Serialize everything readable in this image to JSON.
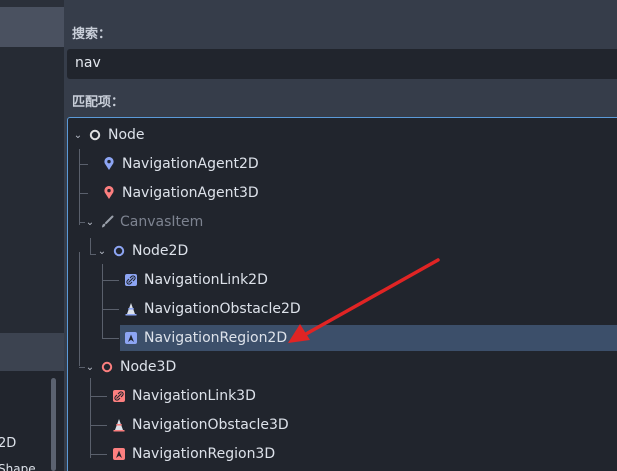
{
  "left_panel": {
    "text_2d": "2D",
    "text_shape": "Shape"
  },
  "search": {
    "label": "搜索：",
    "value": "nav"
  },
  "matches": {
    "label": "匹配项：",
    "items": [
      {
        "label": "Node",
        "icon": "node-circle-icon",
        "color": "#e0e0e0"
      },
      {
        "label": "NavigationAgent2D",
        "icon": "navigation-agent-2d-icon",
        "color": "#8da5f3"
      },
      {
        "label": "NavigationAgent3D",
        "icon": "navigation-agent-3d-icon",
        "color": "#fc7f7f"
      },
      {
        "label": "CanvasItem",
        "icon": "canvas-item-brush-icon",
        "color": "#a5b7f3"
      },
      {
        "label": "Node2D",
        "icon": "node-2d-circle-icon",
        "color": "#8da5f3"
      },
      {
        "label": "NavigationLink2D",
        "icon": "navigation-link-2d-icon",
        "color": "#8da5f3"
      },
      {
        "label": "NavigationObstacle2D",
        "icon": "navigation-obstacle-2d-icon",
        "color": "#8da5f3"
      },
      {
        "label": "NavigationRegion2D",
        "icon": "navigation-region-2d-icon",
        "color": "#8da5f3"
      },
      {
        "label": "Node3D",
        "icon": "node-3d-circle-icon",
        "color": "#fc7f7f"
      },
      {
        "label": "NavigationLink3D",
        "icon": "navigation-link-3d-icon",
        "color": "#fc7f7f"
      },
      {
        "label": "NavigationObstacle3D",
        "icon": "navigation-obstacle-3d-icon",
        "color": "#fc7f7f"
      },
      {
        "label": "NavigationRegion3D",
        "icon": "navigation-region-3d-icon",
        "color": "#fc7f7f"
      }
    ]
  },
  "annotation": {
    "arrow_color": "#e02424",
    "arrow_target": "NavigationRegion2D"
  }
}
